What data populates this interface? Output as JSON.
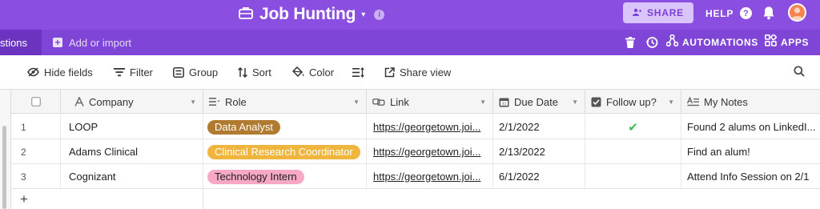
{
  "topbar": {
    "base_title": "Job Hunting",
    "caret": "▾",
    "info_icon": "i",
    "share_label": "SHARE",
    "help_label": "HELP",
    "help_icon": "?"
  },
  "tabbar": {
    "active_tab": "stions",
    "add_import_label": "Add or import",
    "automations_label": "AUTOMATIONS",
    "apps_label": "APPS"
  },
  "viewbar": {
    "hide_fields": "Hide fields",
    "filter": "Filter",
    "group": "Group",
    "sort": "Sort",
    "color": "Color",
    "share_view": "Share view"
  },
  "columns": {
    "company": "Company",
    "role": "Role",
    "link": "Link",
    "due_date": "Due Date",
    "follow_up": "Follow up?",
    "my_notes": "My Notes"
  },
  "rows": [
    {
      "num": "1",
      "company": "LOOP",
      "role": "Data Analyst",
      "role_color": "#b07a2f",
      "role_text_color": "#ffffff",
      "link": "https://georgetown.joi...",
      "due_date": "2/1/2022",
      "follow_up": "✔",
      "notes": "Found 2 alums on LinkedI..."
    },
    {
      "num": "2",
      "company": "Adams Clinical",
      "role": "Clinical Research Coordinator",
      "role_color": "#f0b53d",
      "role_text_color": "#ffffff",
      "link": "https://georgetown.joi...",
      "due_date": "2/13/2022",
      "follow_up": "",
      "notes": "Find an alum!"
    },
    {
      "num": "3",
      "company": "Cognizant",
      "role": "Technology Intern",
      "role_color": "#f7a8c4",
      "role_text_color": "#222222",
      "link": "https://georgetown.joi...",
      "due_date": "6/1/2022",
      "follow_up": "",
      "notes": "Attend Info Session on 2/1"
    }
  ],
  "add_row_label": "+",
  "colors": {
    "topbar": "#8a4fe0",
    "tabbar": "#7f45d7",
    "share_bg": "#d9c5fb",
    "check": "#3dbb4f"
  }
}
